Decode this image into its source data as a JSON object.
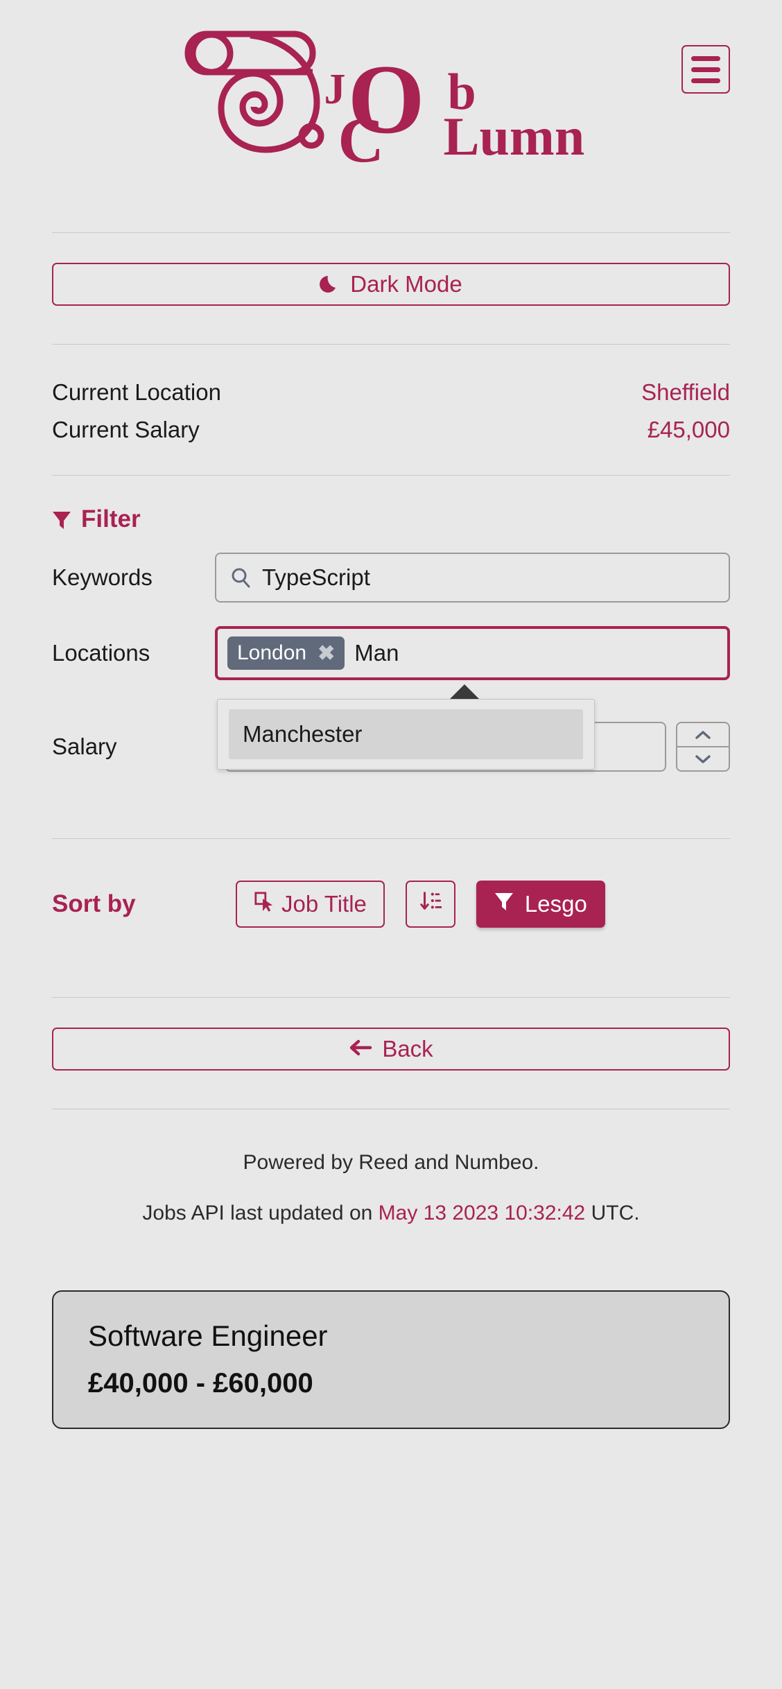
{
  "app": {
    "brand_color": "#a82252",
    "logo": {
      "mark": "scroll-spiral-icon",
      "letters": {
        "j": "J",
        "o": "O",
        "b": "b",
        "c": "C",
        "lumn": "Lumn"
      },
      "full_name": "JobCLumn"
    },
    "menu_button": {
      "icon": "hamburger-icon",
      "label": "Menu"
    }
  },
  "theme_toggle": {
    "icon": "moon-icon",
    "label": "Dark Mode"
  },
  "current": {
    "location_label": "Current Location",
    "location_value": "Sheffield",
    "salary_label": "Current Salary",
    "salary_value": "£45,000"
  },
  "filter": {
    "icon": "funnel-icon",
    "title": "Filter",
    "keywords": {
      "label": "Keywords",
      "icon": "search-icon",
      "value": "TypeScript",
      "placeholder": "Keywords"
    },
    "locations": {
      "label": "Locations",
      "chips": [
        {
          "label": "London",
          "remove_icon": "close-icon"
        }
      ],
      "typed_value": "Man",
      "placeholder": "Locations",
      "suggestions": [
        "Manchester"
      ]
    },
    "salary": {
      "label": "Salary",
      "value": "",
      "placeholder": "",
      "stepper_up": "▲",
      "stepper_down": "▼"
    }
  },
  "sort": {
    "label": "Sort by",
    "field_button": {
      "icon": "cursor-click-icon",
      "label": "Job Title"
    },
    "direction_button": {
      "icon": "sort-descending-icon",
      "label": ""
    },
    "submit_button": {
      "icon": "funnel-icon",
      "label": "Lesgo"
    }
  },
  "back_button": {
    "icon": "arrow-left-icon",
    "label": "Back"
  },
  "footer": {
    "powered_by": "Powered by Reed and Numbeo.",
    "updated_prefix": "Jobs API last updated on",
    "updated_timestamp": "May 13 2023 10:32:42",
    "updated_suffix": "UTC."
  },
  "results": [
    {
      "title": "Software Engineer",
      "salary": "£40,000 - £60,000"
    }
  ]
}
